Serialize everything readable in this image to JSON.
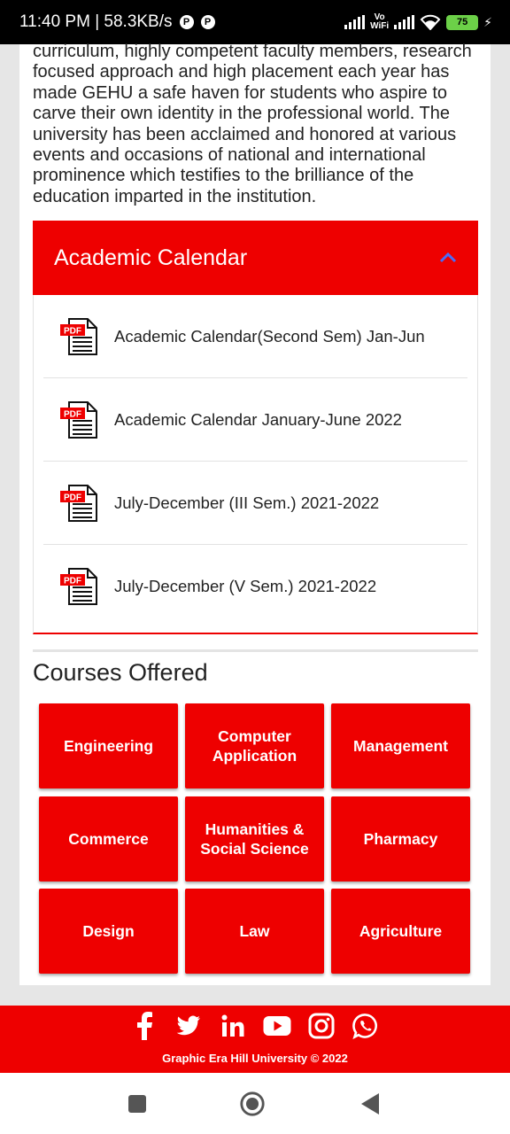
{
  "status_bar": {
    "time_speed": "11:40 PM | 58.3KB/s",
    "vowifi_top": "Vo",
    "vowifi_bottom": "WiFi",
    "battery": "75"
  },
  "intro_text": "curriculum, highly competent faculty members, research focused approach and high placement each year has made GEHU a safe haven for students who aspire to  carve their own identity in the professional world. The university has been acclaimed and honored at various events and occasions of national and international prominence which testifies to the brilliance of the education imparted in the institution.",
  "academic_calendar": {
    "title": "Academic Calendar",
    "items": [
      {
        "label": "Academic Calendar(Second Sem) Jan-Jun",
        "icon": "pdf-icon"
      },
      {
        "label": "Academic Calendar January-June 2022",
        "icon": "pdf-icon"
      },
      {
        "label": "July-December (III Sem.) 2021-2022",
        "icon": "pdf-icon"
      },
      {
        "label": "July-December (V Sem.) 2021-2022",
        "icon": "pdf-icon"
      }
    ],
    "pdf_badge": "PDF"
  },
  "courses": {
    "title": "Courses Offered",
    "items": [
      "Engineering",
      "Computer Application",
      "Management",
      "Commerce",
      "Humanities & Social Science",
      "Pharmacy",
      "Design",
      "Law",
      "Agriculture"
    ]
  },
  "footer": {
    "socials": [
      "facebook-icon",
      "twitter-icon",
      "linkedin-icon",
      "youtube-icon",
      "instagram-icon",
      "whatsapp-icon"
    ],
    "copyright": "Graphic Era Hill University © 2022"
  },
  "colors": {
    "brand_red": "#ee0000",
    "chevron_blue": "#4a6cf7"
  }
}
